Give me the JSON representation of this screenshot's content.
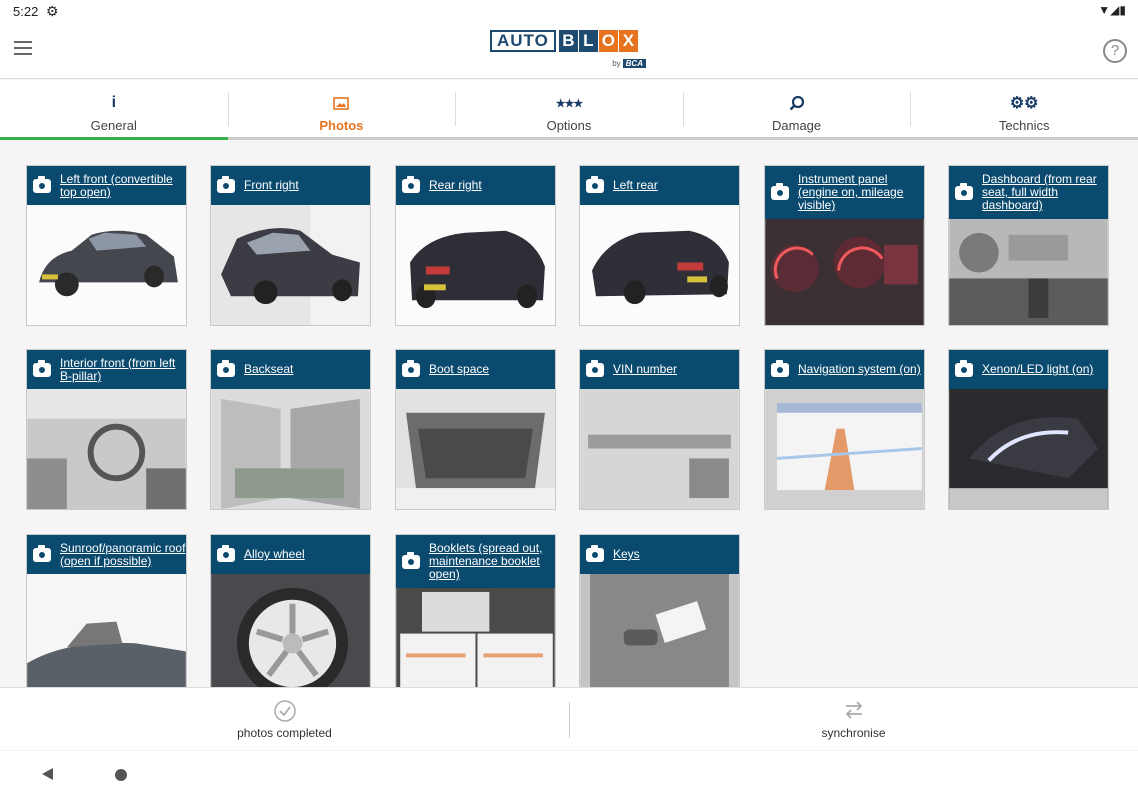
{
  "status": {
    "time": "5:22"
  },
  "app": {
    "logo_main": "AUTO",
    "logo_letters": [
      "B",
      "L",
      "O",
      "X"
    ],
    "logo_by": "by",
    "logo_bca": "BCA"
  },
  "tabs": [
    {
      "label": "General",
      "icon": "info-icon"
    },
    {
      "label": "Photos",
      "icon": "image-icon"
    },
    {
      "label": "Options",
      "icon": "stars-icon"
    },
    {
      "label": "Damage",
      "icon": "magnifier-icon"
    },
    {
      "label": "Technics",
      "icon": "gears-icon"
    }
  ],
  "photos": [
    {
      "label": "Left front (convertible top open)"
    },
    {
      "label": "Front right"
    },
    {
      "label": "Rear right"
    },
    {
      "label": "Left rear"
    },
    {
      "label": "Instrument panel (engine on, mileage visible)"
    },
    {
      "label": "Dashboard (from rear seat, full width dashboard)"
    },
    {
      "label": "Interior front (from left B-pillar)"
    },
    {
      "label": "Backseat"
    },
    {
      "label": "Boot space"
    },
    {
      "label": "VIN number"
    },
    {
      "label": "Navigation system (on)"
    },
    {
      "label": "Xenon/LED light (on)"
    },
    {
      "label": "Sunroof/panoramic roof (open if possible)"
    },
    {
      "label": "Alloy wheel"
    },
    {
      "label": "Booklets (spread out, maintenance booklet open)"
    },
    {
      "label": "Keys"
    }
  ],
  "bottom": {
    "completed_label": "photos completed",
    "sync_label": "synchronise"
  },
  "colors": {
    "header": "#0b4a6f",
    "accent": "#e8731f",
    "active_bar": "#35b34a"
  }
}
